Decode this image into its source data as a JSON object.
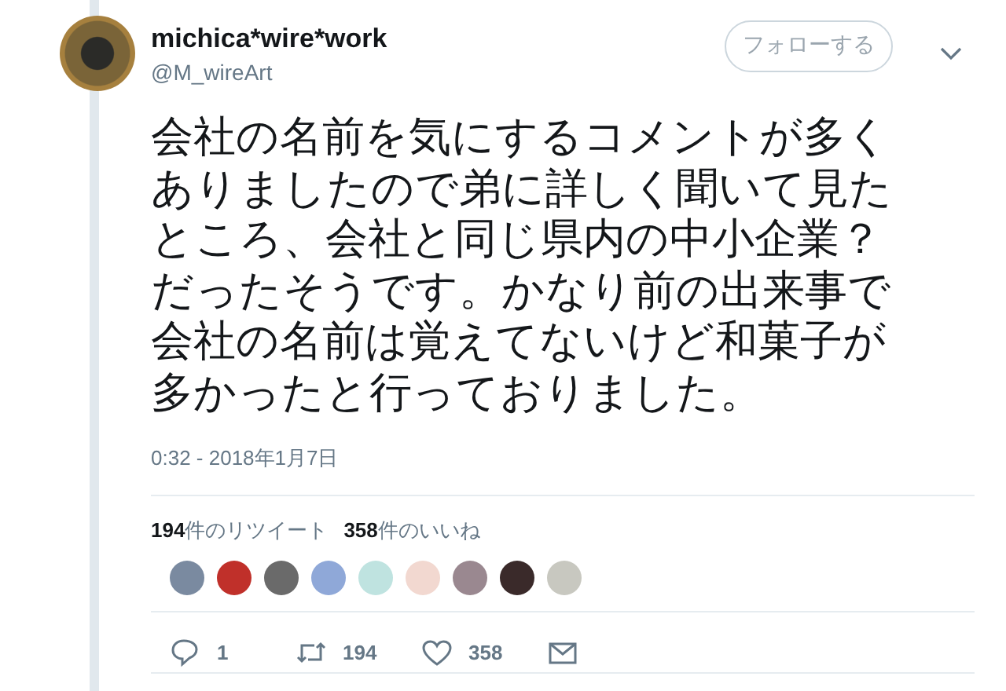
{
  "tweet": {
    "display_name": "michica*wire*work",
    "handle": "@M_wireArt",
    "follow_button": "フォローする",
    "text": "会社の名前を気にするコメントが多くありましたので弟に詳しく聞いて見たところ、会社と同じ県内の中小企業？だったそうです。かなり前の出来事で会社の名前は覚えてないけど和菓子が多かったと行っておりました。",
    "timestamp": "0:32 - 2018年1月7日",
    "stats": [
      "**194**件のリツイート",
      "**358**件のいいね"
    ],
    "liker_avatars": [
      {
        "color": "#7a8aa0"
      },
      {
        "color": "#c0302a"
      },
      {
        "color": "#6a6a6a"
      },
      {
        "color": "#8fa8d8"
      },
      {
        "color": "#bfe3e0"
      },
      {
        "color": "#f2d8d0"
      },
      {
        "color": "#9a8890"
      },
      {
        "color": "#3a2a2a"
      },
      {
        "color": "#c8c8c0"
      }
    ],
    "actions": [
      {
        "kind": "reply",
        "count": "1"
      },
      {
        "kind": "retweet",
        "count": "194"
      },
      {
        "kind": "like",
        "count": "358"
      },
      {
        "kind": "message"
      }
    ]
  }
}
